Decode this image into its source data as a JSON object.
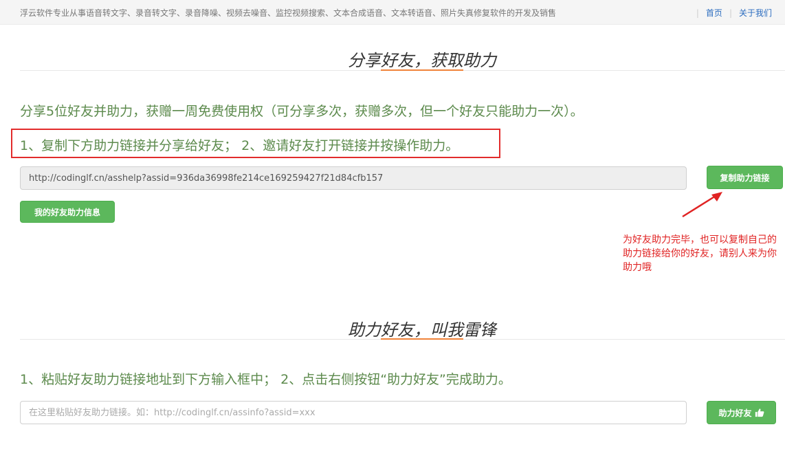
{
  "topbar": {
    "description": "浮云软件专业从事语音转文字、录音转文字、录音降噪、视频去噪音、监控视频搜索、文本合成语音、文本转语音、照片失真修复软件的开发及销售",
    "nav": {
      "separator": "|",
      "home": "首页",
      "about": "关于我们"
    }
  },
  "share_section": {
    "title": "分享好友，获取助力",
    "intro": "分享5位好友并助力，获赠一周免费使用权（可分享多次，获赠多次，但一个好友只能助力一次）。",
    "steps": "1、复制下方助力链接并分享给好友；  2、邀请好友打开链接并按操作助力。",
    "link_value": "http://codinglf.cn/asshelp?assid=936da36998fe214ce169259427f21d84cfb157",
    "copy_button": "复制助力链接",
    "my_info_button": "我的好友助力信息",
    "annotation": "为好友助力完毕，也可以复制自己的助力链接给你的好友，请别人来为你助力哦"
  },
  "help_section": {
    "title": "助力好友，叫我雷锋",
    "steps": "1、粘贴好友助力链接地址到下方输入框中；  2、点击右侧按钮“助力好友”完成助力。",
    "input_placeholder": "在这里粘贴好友助力链接。如：http://codinglf.cn/assinfo?assid=xxx",
    "help_button": "助力好友",
    "help_button_icon": "thumbs-up-icon"
  },
  "colors": {
    "accent_orange": "#f0833a",
    "green_text": "#5c8a4c",
    "button_green": "#5cb85c",
    "annotation_red": "#e02323"
  }
}
